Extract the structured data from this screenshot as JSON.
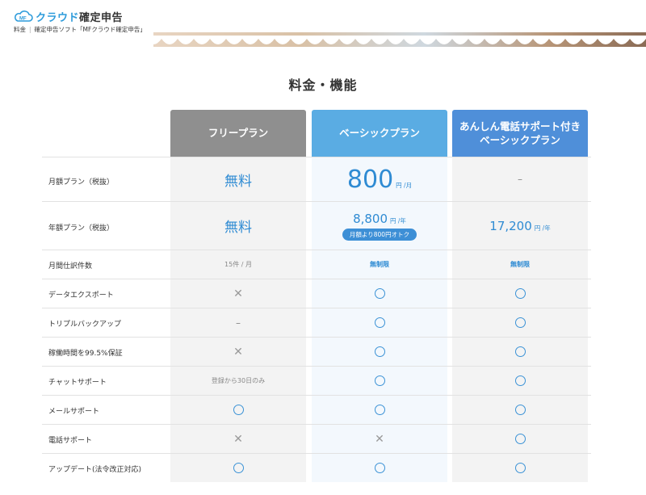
{
  "header": {
    "logo_mf": "MF",
    "logo_blue": "クラウド",
    "logo_dark": "確定申告",
    "breadcrumb": [
      "料金",
      "確定申告ソフト「MFクラウド確定申告」"
    ]
  },
  "page_title": "料金・機能",
  "plans": [
    {
      "name": "フリープラン"
    },
    {
      "name": "ベーシックプラン"
    },
    {
      "name_line1": "あんしん電話サポート付き",
      "name_line2": "ベーシックプラン"
    }
  ],
  "rows": {
    "monthly": {
      "label": "月額プラン（税抜）",
      "free": "無料",
      "basic_value": "800",
      "basic_unit": "円 /月",
      "support": "–"
    },
    "yearly": {
      "label": "年額プラン（税抜）",
      "free": "無料",
      "basic_value": "8,800",
      "basic_unit": "円 /年",
      "basic_badge": "月額より800円オトク",
      "support_value": "17,200",
      "support_unit": "円 /年"
    },
    "journal": {
      "label": "月間仕訳件数",
      "free": "15件 / 月",
      "basic": "無制限",
      "support": "無制限"
    },
    "features": [
      {
        "label": "データエクスポート",
        "free": "cross",
        "basic": "circle",
        "support": "circle"
      },
      {
        "label": "トリプルバックアップ",
        "free": "dash",
        "basic": "circle",
        "support": "circle"
      },
      {
        "label": "稼働時間を99.5%保証",
        "free": "cross",
        "basic": "circle",
        "support": "circle"
      },
      {
        "label": "チャットサポート",
        "free": "登録から30日のみ",
        "basic": "circle",
        "support": "circle"
      },
      {
        "label": "メールサポート",
        "free": "circle",
        "basic": "circle",
        "support": "circle"
      },
      {
        "label": "電話サポート",
        "free": "cross",
        "basic": "cross",
        "support": "circle"
      },
      {
        "label": "アップデート(法令改正対応)",
        "free": "circle",
        "basic": "circle",
        "support": "circle"
      }
    ]
  },
  "symbols": {
    "cross": "✕",
    "dash": "–"
  },
  "colors": {
    "brand": "#2f9cdb",
    "free_header": "#8f8f8f",
    "basic_header": "#5aace3",
    "support_header": "#4f8fd9",
    "circle": "#3b92d6"
  }
}
